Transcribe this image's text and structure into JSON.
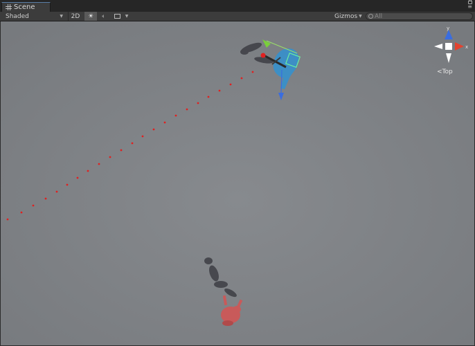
{
  "window": {
    "tab_label": "Scene",
    "tab_icon": "grid-icon"
  },
  "toolbar": {
    "draw_mode": "Shaded",
    "mode_2d": "2D",
    "lighting_icon": "sun-icon",
    "audio_icon": "speaker-icon",
    "effects_icon": "image-icon",
    "gizmos_label": "Gizmos",
    "search_placeholder": "All"
  },
  "scene_gizmo": {
    "label": "Top",
    "axis_y": "y",
    "axis_x": "x",
    "colors": {
      "x": "#e3432f",
      "y": "#7ad03a",
      "z": "#3a6de0",
      "neutral": "#ffffff"
    }
  },
  "scene": {
    "background": "#7d7f83",
    "player_color": "#3a8fc8",
    "enemy_color": "#c85a5a",
    "path_color": "#e02020"
  }
}
